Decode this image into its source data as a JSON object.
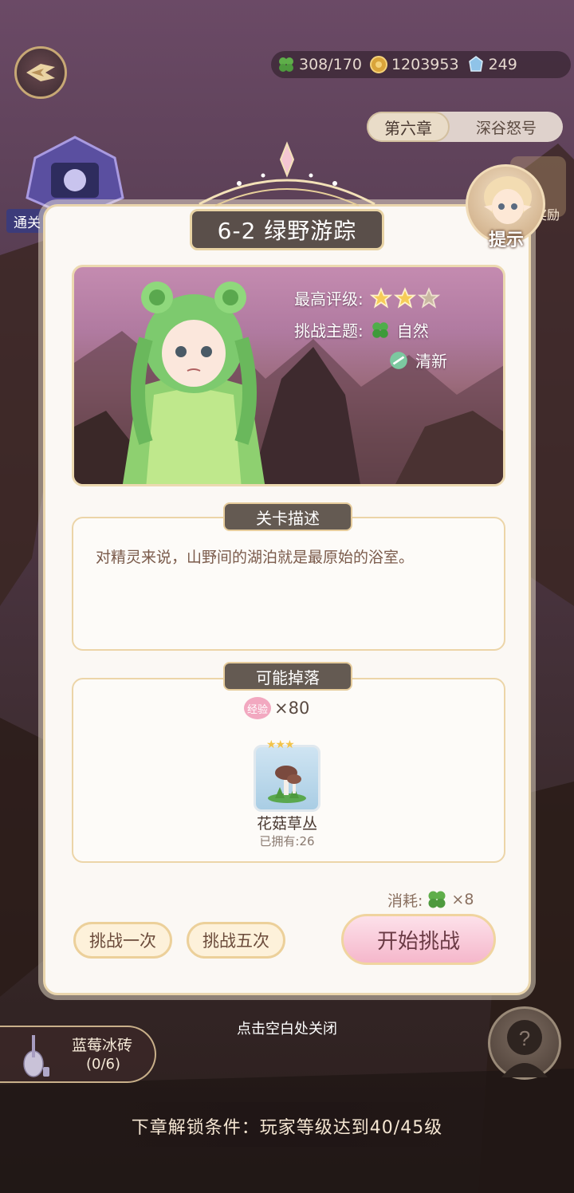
{
  "resources": {
    "stamina": "308/170",
    "gold": "1203953",
    "gems": "249"
  },
  "chapter": {
    "number": "第六章",
    "name": "深谷怒号"
  },
  "left_badge_label": "通关",
  "hint_label": "提示",
  "reward_label": "奖励",
  "stage": {
    "title": "6-2  绿野游踪",
    "best_rating_label": "最高评级:",
    "best_rating_stars": 2,
    "theme_label": "挑战主题:",
    "themes": [
      "自然",
      "清新"
    ]
  },
  "description": {
    "tab": "关卡描述",
    "text": "对精灵来说，山野间的湖泊就是最原始的浴室。"
  },
  "drops": {
    "tab": "可能掉落",
    "exp_badge": "经验",
    "exp_amount": "×80",
    "item_name": "花菇草丛",
    "item_owned": "已拥有:26"
  },
  "cost": {
    "label": "消耗:",
    "amount": "×8"
  },
  "buttons": {
    "challenge_once": "挑战一次",
    "challenge_five": "挑战五次",
    "start": "开始挑战"
  },
  "close_hint": "点击空白处关闭",
  "bottom_task": {
    "title": "蓝莓冰砖",
    "count": "(0/6)"
  },
  "unlock_condition": "下章解锁条件：玩家等级达到40/45级",
  "colors": {
    "accent_gold": "#ecd09a",
    "plate_dark": "#5a4f4a",
    "start_pink": "#f5b7cb"
  }
}
